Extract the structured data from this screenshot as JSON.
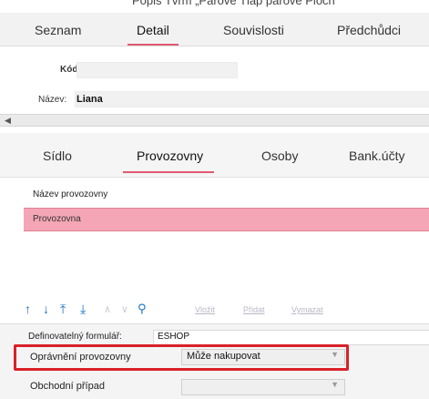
{
  "top_cut_text": "Popis Tvrm „Párové Tlap párové Ploch",
  "top_tabs": [
    {
      "label": "Seznam",
      "active": false
    },
    {
      "label": "Detail",
      "active": true
    },
    {
      "label": "Souvislosti",
      "active": false
    },
    {
      "label": "Předchůdci",
      "active": false
    }
  ],
  "form": {
    "kod_label": "Kód:",
    "kod_value": "",
    "nazev_label": "Název:",
    "nazev_value": "Liana"
  },
  "sub_tabs": [
    {
      "label": "Sídlo",
      "active": false
    },
    {
      "label": "Provozovny",
      "active": true
    },
    {
      "label": "Osoby",
      "active": false
    },
    {
      "label": "Bank.účty",
      "active": false
    }
  ],
  "grid": {
    "column_header": "Název provozovny",
    "rows": [
      {
        "name": "Provozovna",
        "selected": true
      }
    ]
  },
  "toolbar": {
    "icons": [
      {
        "name": "move-up-icon",
        "glyph": "↑",
        "enabled": true
      },
      {
        "name": "move-down-icon",
        "glyph": "↓",
        "enabled": true
      },
      {
        "name": "move-top-icon",
        "glyph": "⤒",
        "enabled": true
      },
      {
        "name": "move-bottom-icon",
        "glyph": "⤓",
        "enabled": true
      },
      {
        "name": "chevron-up-icon",
        "glyph": "∧",
        "enabled": false
      },
      {
        "name": "chevron-down-icon",
        "glyph": "∨",
        "enabled": false
      },
      {
        "name": "search-icon",
        "glyph": "🔍",
        "enabled": true
      }
    ],
    "links": [
      {
        "label": "Vložit",
        "enabled": false
      },
      {
        "label": "Přidat",
        "enabled": false
      },
      {
        "label": "Vymazat",
        "enabled": false
      }
    ]
  },
  "bottom": {
    "definovatelny_label": "Definovatelný formulář:",
    "definovatelny_value": "ESHOP",
    "opravneni_label": "Oprávnění provozovny",
    "opravneni_value": "Může nakupovat",
    "obchodni_label": "Obchodní případ",
    "obchodni_value": ""
  },
  "colors": {
    "accent_underline": "#e05a72",
    "selected_row": "#f4a6b6",
    "toolbar_icon": "#1a6fc4",
    "highlight_box": "#d9202a"
  }
}
